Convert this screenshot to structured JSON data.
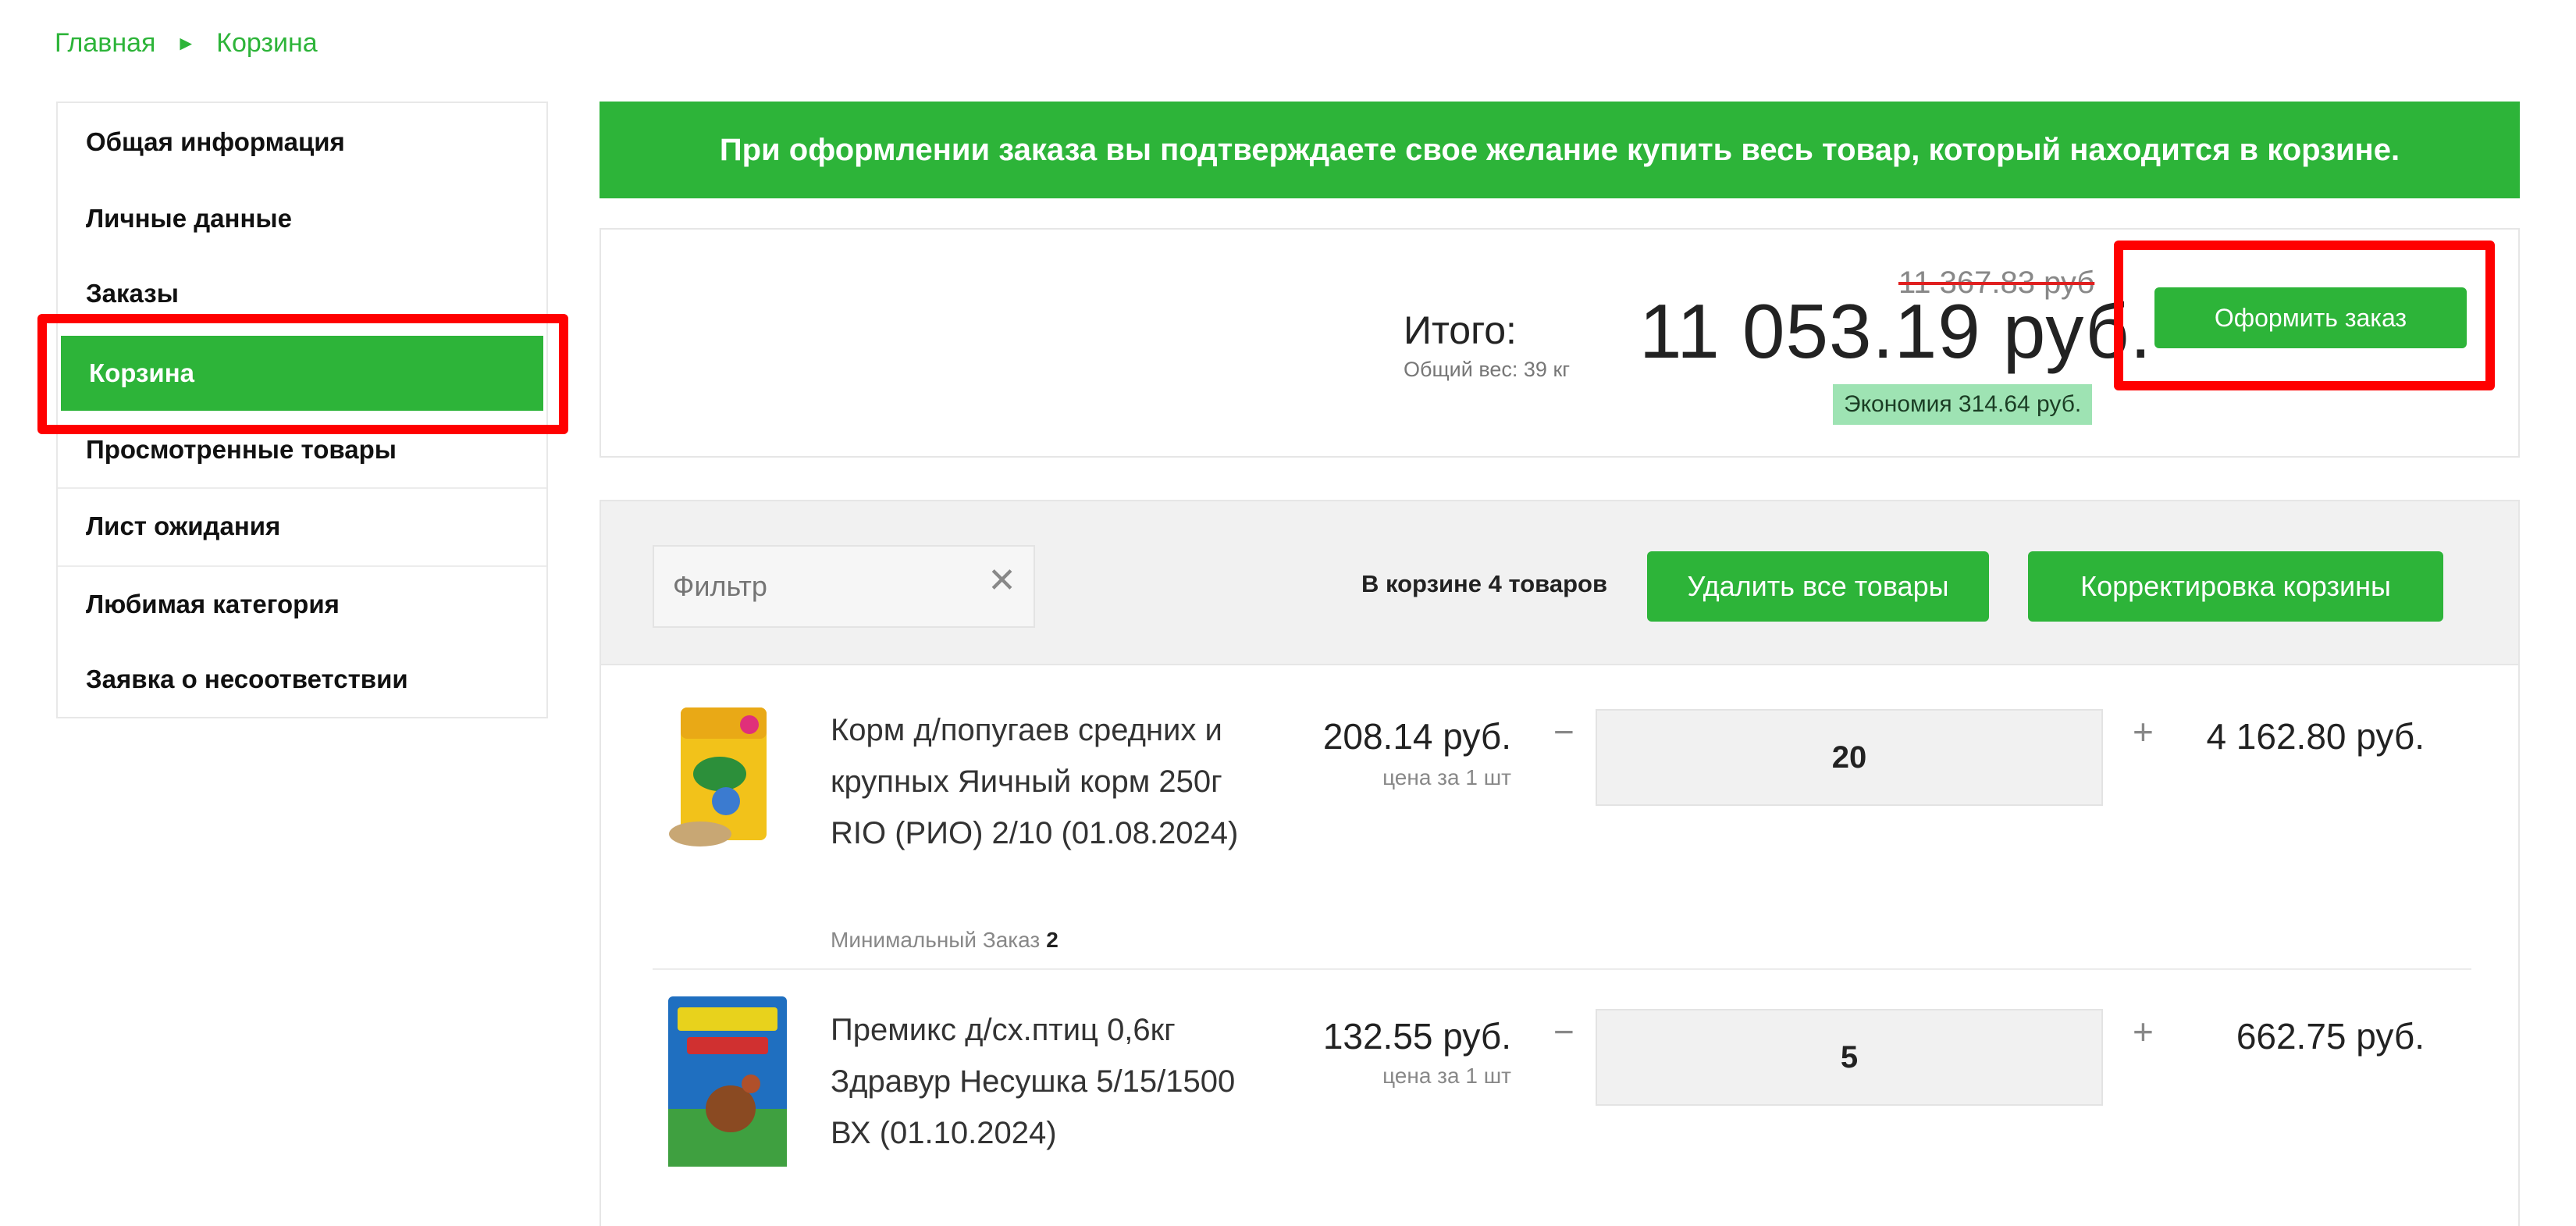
{
  "breadcrumb": {
    "home": "Главная",
    "separator": "►",
    "current": "Корзина"
  },
  "sidebar": {
    "items": [
      {
        "label": "Общая информация"
      },
      {
        "label": "Личные данные"
      },
      {
        "label": "Заказы"
      },
      {
        "label": "Корзина",
        "active": true
      },
      {
        "label": "Просмотренные товары"
      },
      {
        "label": "Лист ожидания"
      },
      {
        "label": "Любимая категория"
      },
      {
        "label": "Заявка о несоответствии"
      }
    ]
  },
  "banner": {
    "text": "При оформлении заказа вы подтверждаете свое желание купить весь товар, который находится в корзине."
  },
  "summary": {
    "total_label": "Итого:",
    "weight": "Общий вес: 39 кг",
    "old_price": "11 367.83 руб",
    "total": "11 053.19 руб.",
    "saving": "Экономия 314.64 руб.",
    "order_button": "Оформить заказ"
  },
  "toolbar": {
    "filter_placeholder": "Фильтр",
    "clear_icon": "close-icon",
    "cart_count": "В корзине 4 товаров",
    "delete_all": "Удалить все товары",
    "adjust_cart": "Корректировка корзины"
  },
  "items": [
    {
      "name": "Корм д/попугаев средних и крупных Яичный корм 250г RIO (РИО) 2/10 (01.08.2024)",
      "min_order_label": "Минимальный Заказ",
      "min_order": "2",
      "price": "208.14 руб.",
      "price_note": "цена за 1 шт",
      "minus": "−",
      "quantity": "20",
      "plus": "+",
      "sum": "4 162.80 руб."
    },
    {
      "name": "Премикс д/сх.птиц 0,6кг Здравур Несушка 5/15/1500 ВХ (01.10.2024)",
      "price": "132.55 руб.",
      "price_note": "цена за 1 шт",
      "minus": "−",
      "quantity": "5",
      "plus": "+",
      "sum": "662.75 руб."
    }
  ],
  "colors": {
    "accent": "#2db439",
    "highlight": "#ff0000",
    "saving_bg": "#9ee3b3"
  }
}
